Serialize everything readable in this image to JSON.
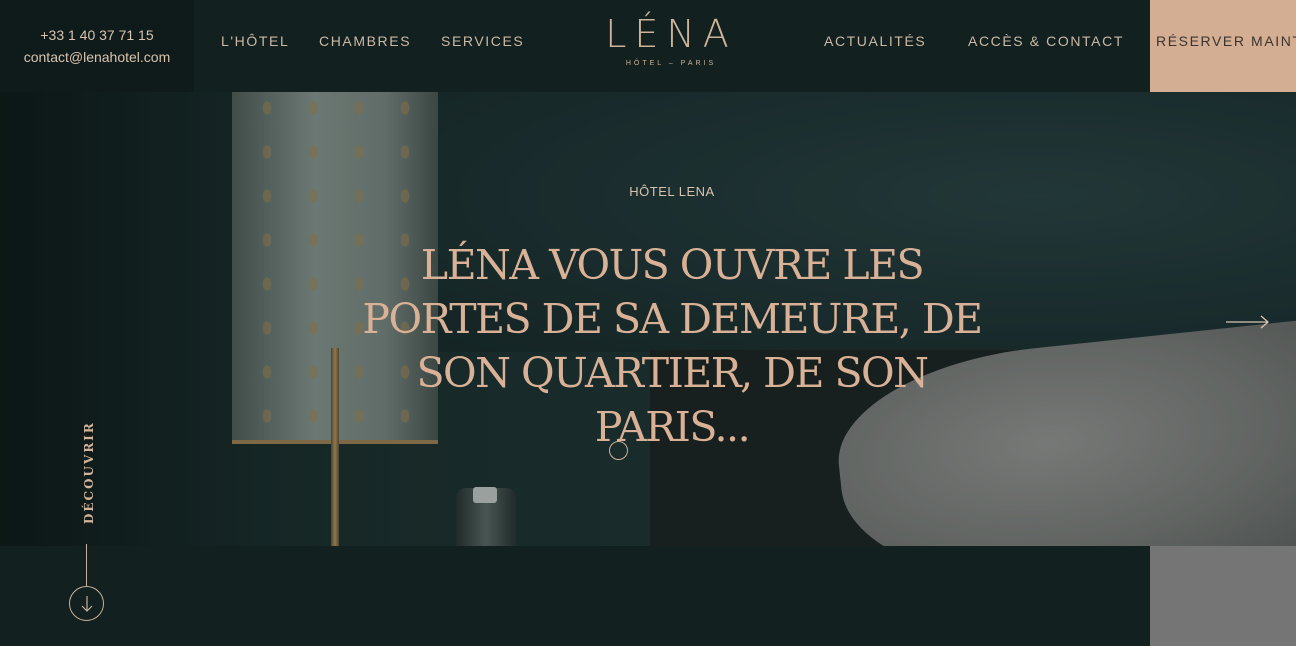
{
  "header": {
    "phone": "+33 1 40 37 71 15",
    "email": "contact@lenahotel.com",
    "nav_left": [
      "L'HÔTEL",
      "CHAMBRES",
      "SERVICES"
    ],
    "nav_right": [
      "ACTUALITÉS",
      "ACCÈS & CONTACT"
    ],
    "logo_main": "LÉNA",
    "logo_sub": "HÔTEL – PARIS",
    "reserve_label": "RÉSERVER MAINT"
  },
  "hero": {
    "eyebrow": "HÔTEL LENA",
    "headline": "LÉNA VOUS OUVRE LES PORTES DE SA DEMEURE, DE SON QUARTIER, DE SON PARIS...",
    "next_icon": "arrow-right-icon",
    "dot_icon": "slide-indicator-icon"
  },
  "discover": {
    "label": "DÉCOUVRIR",
    "icon": "arrow-down-icon"
  },
  "colors": {
    "background": "#12201f",
    "accent": "#d4ae92",
    "headline": "#d9b196",
    "text": "#cbb9a6"
  }
}
